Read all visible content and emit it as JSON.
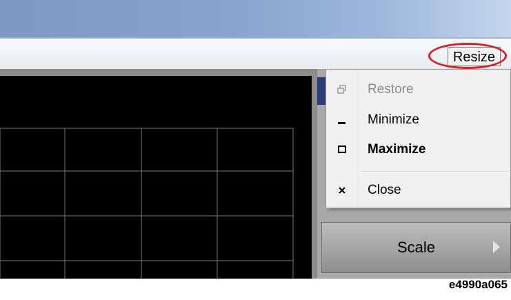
{
  "menubar": {
    "resize_label": "Resize"
  },
  "context_menu": {
    "items": [
      {
        "label": "Restore",
        "icon": "restore-icon"
      },
      {
        "label": "Minimize",
        "icon": "minimize-icon"
      },
      {
        "label": "Maximize",
        "icon": "maximize-icon"
      },
      {
        "label": "Close",
        "icon": "close-icon"
      }
    ]
  },
  "softkeys": {
    "scale_label": "Scale"
  },
  "caption": "e4990a065",
  "colors": {
    "highlight": "#e21b23",
    "screen": "#000000",
    "grid": "#7a7a7a"
  }
}
